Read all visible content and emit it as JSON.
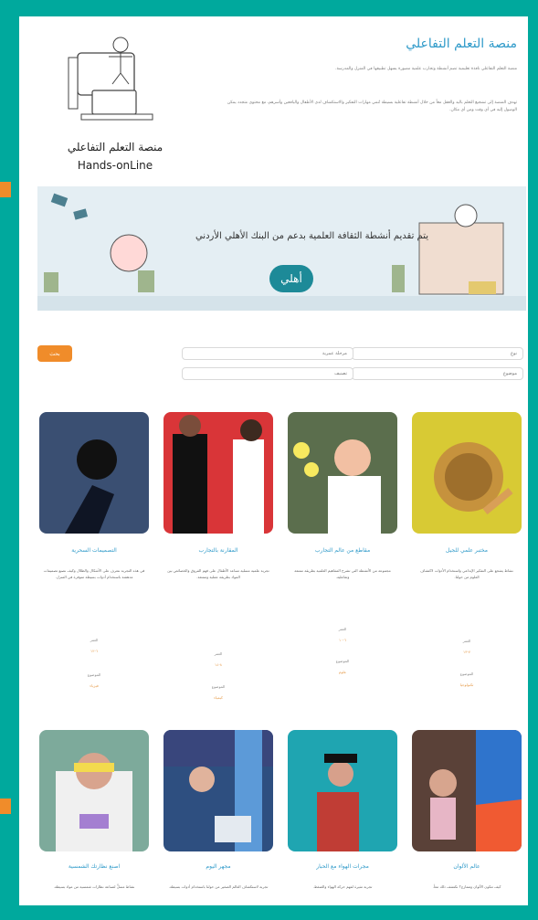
{
  "page": {
    "title": "منصة التعلم التفاعلي",
    "intro": "منصة التعلم التفاعلي نافذة تعليمية تضم أنشطة وتجارب علمية مصورة يسهل تطبيقها في المنزل والمدرسة.",
    "body": "تهدف المنصة إلى تشجيع التعلم باليد والعقل معاً من خلال أنشطة تفاعلية بسيطة تُنمي مهارات التفكير والاستكشاف لدى الأطفال واليافعين وأسرهم، مع محتوى متجدد يمكن الوصول إليه في أي وقت ومن أي مكان.",
    "logo_ar": "منصة التعلم التفاعلي",
    "logo_en": "Hands-onLine"
  },
  "banner": {
    "text": "يتم تقديم أنشطة الثقافة العلمية بدعم من البنك الأهلي الأردني",
    "brand": "أهلي"
  },
  "filters": {
    "submit": "بحث",
    "top_right": "نوع",
    "top_middle": "مرحلة عمرية",
    "bottom_right": "موضوع",
    "bottom_middle": "تصنيف"
  },
  "cards_row1": [
    {
      "title": "التصميمات السحرية",
      "desc": "في هذه التجربة نتعرف على الأشكال والظلال وكيف نصنع تصميمات مدهشة باستخدام أدوات بسيطة متوفرة في المنزل.",
      "meta1": "العمر",
      "meta1_val": "٦-١٢",
      "meta2": "الموضوع",
      "meta2_val": "فيزياء"
    },
    {
      "title": "المقارنة بالتجارب",
      "desc": "تجربة علمية مسلية تساعد الأطفال على فهم الفروق والخصائص بين المواد بطريقة عملية وممتعة.",
      "meta1": "العمر",
      "meta1_val": "٨-١٤",
      "meta2": "الموضوع",
      "meta2_val": "كيمياء"
    },
    {
      "title": "مقاطع من عالم التجارب",
      "desc": "مجموعة من الأنشطة التي تشرح المفاهيم العلمية بطريقة ممتعة وتفاعلية.",
      "meta1": "العمر",
      "meta1_val": "٦-١٠",
      "meta2": "الموضوع",
      "meta2_val": "علوم"
    },
    {
      "title": "مختبر علمي للجيل",
      "desc": "نشاط يشجع على التفكير الإبداعي واستخدام الأدوات لاكتشاف العلوم من حولنا.",
      "meta1": "العمر",
      "meta1_val": "٧-١٣",
      "meta2": "الموضوع",
      "meta2_val": "تكنولوجيا"
    }
  ],
  "cards_row2": [
    {
      "title": "اصنع نظارتك الشمسية",
      "desc": "نشاط مسلٍّ لصناعة نظارات شمسية من مواد بسيطة."
    },
    {
      "title": "مجهر اليوم",
      "desc": "تجربة لاستكشاف العالم الصغير من حولنا باستخدام أدوات بسيطة."
    },
    {
      "title": "مجرات الهواء مع الحبار",
      "desc": "تجربة مثيرة لفهم حركة الهواء والضغط."
    },
    {
      "title": "عالم الألوان",
      "desc": "كيف تتكون الألوان وتتمازج؟ نكتشف ذلك معاً."
    }
  ]
}
